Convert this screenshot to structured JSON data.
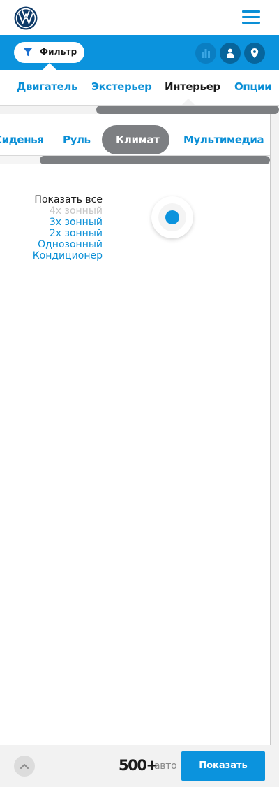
{
  "header": {
    "logo_icon": "volkswagen-logo",
    "menu_icon": "hamburger-menu-icon",
    "accent_color": "#0b93dd"
  },
  "filterbar": {
    "filter_label": "Фильтр",
    "filter_icon": "funnel-icon",
    "actions": [
      {
        "icon": "bar-chart-icon",
        "enabled": false
      },
      {
        "icon": "user-icon",
        "enabled": true
      },
      {
        "icon": "map-pin-icon",
        "enabled": true
      }
    ]
  },
  "category_tabs": {
    "items": [
      "Двигатель",
      "Экстерьер",
      "Интерьер",
      "Опции"
    ],
    "active": "Интерьер"
  },
  "subcategory_tabs": {
    "items": [
      "Сиденья",
      "Руль",
      "Климат",
      "Мультимедиа"
    ],
    "active": "Климат"
  },
  "climate_filter": {
    "options": [
      {
        "label": "Показать все",
        "state": "default"
      },
      {
        "label": "4х зонный",
        "state": "disabled"
      },
      {
        "label": "3х зонный",
        "state": "link"
      },
      {
        "label": "2х зонный",
        "state": "link"
      },
      {
        "label": "Однозонный",
        "state": "link"
      },
      {
        "label": "Кондиционер",
        "state": "link"
      }
    ],
    "toggle_selected": true
  },
  "footer": {
    "scroll_top_icon": "chevron-up-icon",
    "count": "500+",
    "count_unit": "авто",
    "show_label": "Показать"
  }
}
